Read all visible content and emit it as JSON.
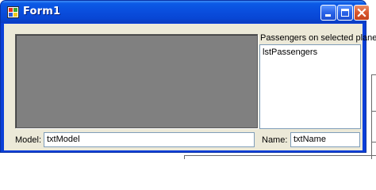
{
  "window": {
    "title": "Form1",
    "icon": "app-icon",
    "controls": [
      "minimize-icon",
      "maximize-icon",
      "close-icon"
    ]
  },
  "passengers": {
    "label": "Passengers on selected plane:",
    "list_items": [
      "lstPassengers"
    ]
  },
  "picture": {
    "color": "#808080"
  },
  "model": {
    "label": "Model:",
    "value": "txtModel"
  },
  "name": {
    "label": "Name:",
    "value": "txtName"
  },
  "colors": {
    "titlebar": "#0a4fde",
    "client": "#ece9d8",
    "border": "#7f9db9"
  }
}
